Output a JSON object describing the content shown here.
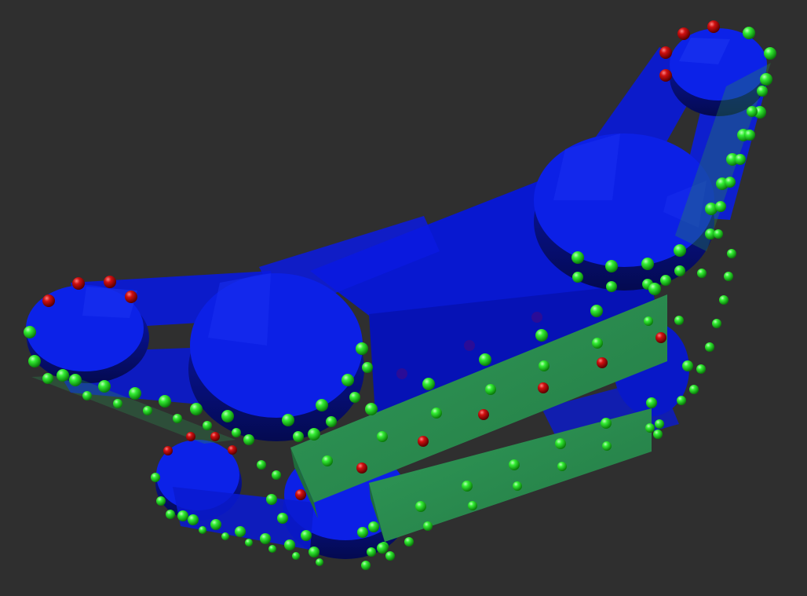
{
  "viewport": {
    "background_color": "#2f2f2f"
  },
  "model": {
    "body_color": "#0a1ae6",
    "body_dark_color": "#06108c",
    "plate_color": "#2a8a4e",
    "plate_edge_color": "#1f6b3b",
    "green_marker_color": "#22e622",
    "red_marker_color": "#c80a0a"
  }
}
